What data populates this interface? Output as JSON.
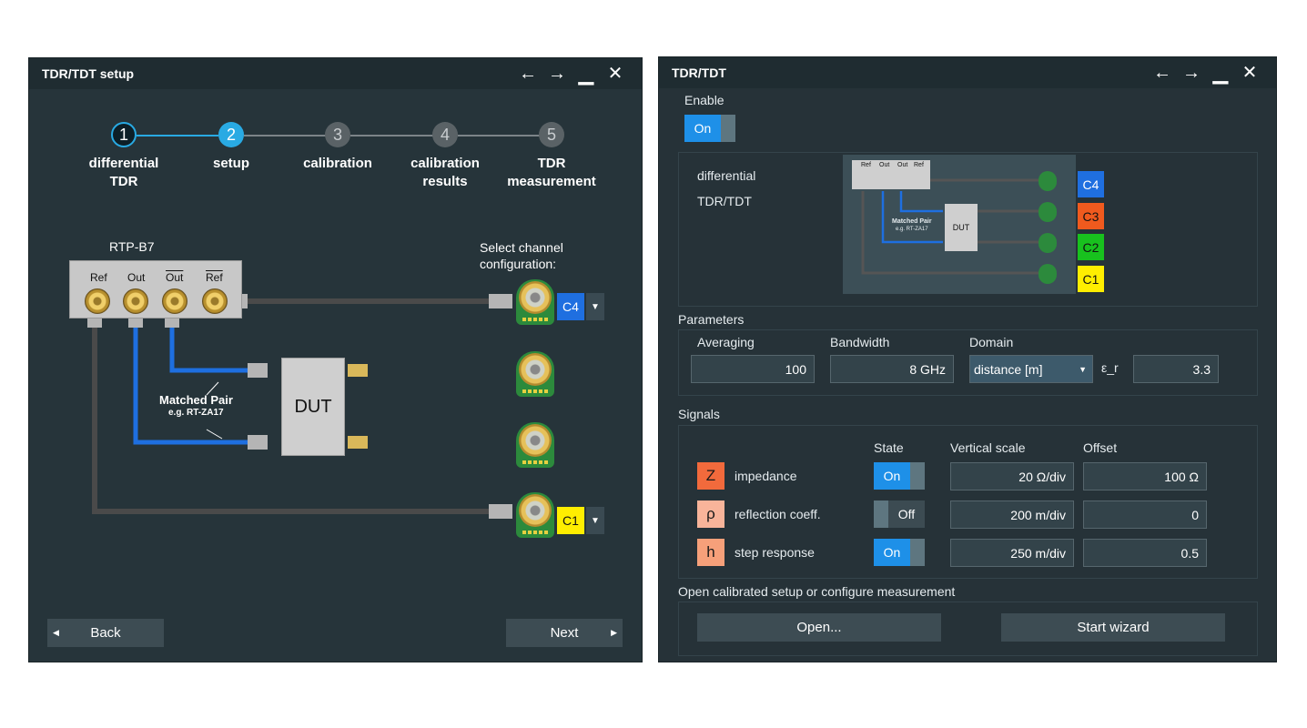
{
  "left_window": {
    "title": "TDR/TDT setup",
    "steps": [
      {
        "num": "1",
        "label": "differential\nTDR",
        "state": "done"
      },
      {
        "num": "2",
        "label": "setup",
        "state": "active"
      },
      {
        "num": "3",
        "label": "calibration",
        "state": "inactive"
      },
      {
        "num": "4",
        "label": "calibration\nresults",
        "state": "inactive"
      },
      {
        "num": "5",
        "label": "TDR\nmeasurement",
        "state": "inactive"
      }
    ],
    "device_label": "RTP-B7",
    "ports": [
      "Ref",
      "Out",
      "Out",
      "Ref"
    ],
    "select_label": "Select channel\nconfiguration:",
    "matched_pair": "Matched Pair",
    "matched_pair_sub": "e.g. RT-ZA17",
    "dut_label": "DUT",
    "channels": {
      "top": "C4",
      "bottom": "C1"
    },
    "back_label": "Back",
    "next_label": "Next",
    "colors": {
      "accent": "#29aae3",
      "c4": "#1f6fe0",
      "c1": "#ffee00"
    }
  },
  "right_window": {
    "title": "TDR/TDT",
    "enable_label": "Enable",
    "enable_state": "On",
    "diagram_text_1": "differential",
    "diagram_text_2": "TDR/TDT",
    "mini_ports": [
      "Ref",
      "Out",
      "Out",
      "Ref"
    ],
    "mini_matched_pair": "Matched Pair",
    "mini_matched_sub": "e.g. RT-ZA17",
    "mini_dut": "DUT",
    "mini_channels": [
      "C4",
      "C3",
      "C2",
      "C1"
    ],
    "parameters_label": "Parameters",
    "averaging_label": "Averaging",
    "averaging_value": "100",
    "bandwidth_label": "Bandwidth",
    "bandwidth_value": "8 GHz",
    "domain_label": "Domain",
    "domain_value": "distance [m]",
    "epsilon_label": "ε_r",
    "epsilon_value": "3.3",
    "signals_label": "Signals",
    "state_header": "State",
    "vscale_header": "Vertical scale",
    "offset_header": "Offset",
    "signals": [
      {
        "icon": "Z",
        "name": "impedance",
        "state": "On",
        "vscale": "20 Ω/div",
        "offset": "100 Ω"
      },
      {
        "icon": "ρ",
        "name": "reflection coeff.",
        "state": "Off",
        "vscale": "200 m/div",
        "offset": "0"
      },
      {
        "icon": "h",
        "name": "step response",
        "state": "On",
        "vscale": "250 m/div",
        "offset": "0.5"
      }
    ],
    "open_section_label": "Open calibrated setup or configure measurement",
    "open_button": "Open...",
    "wizard_button": "Start wizard"
  },
  "icons": {
    "back": "arrow-left-icon",
    "forward": "arrow-right-icon",
    "minimize": "minimize-icon",
    "close": "close-icon"
  }
}
